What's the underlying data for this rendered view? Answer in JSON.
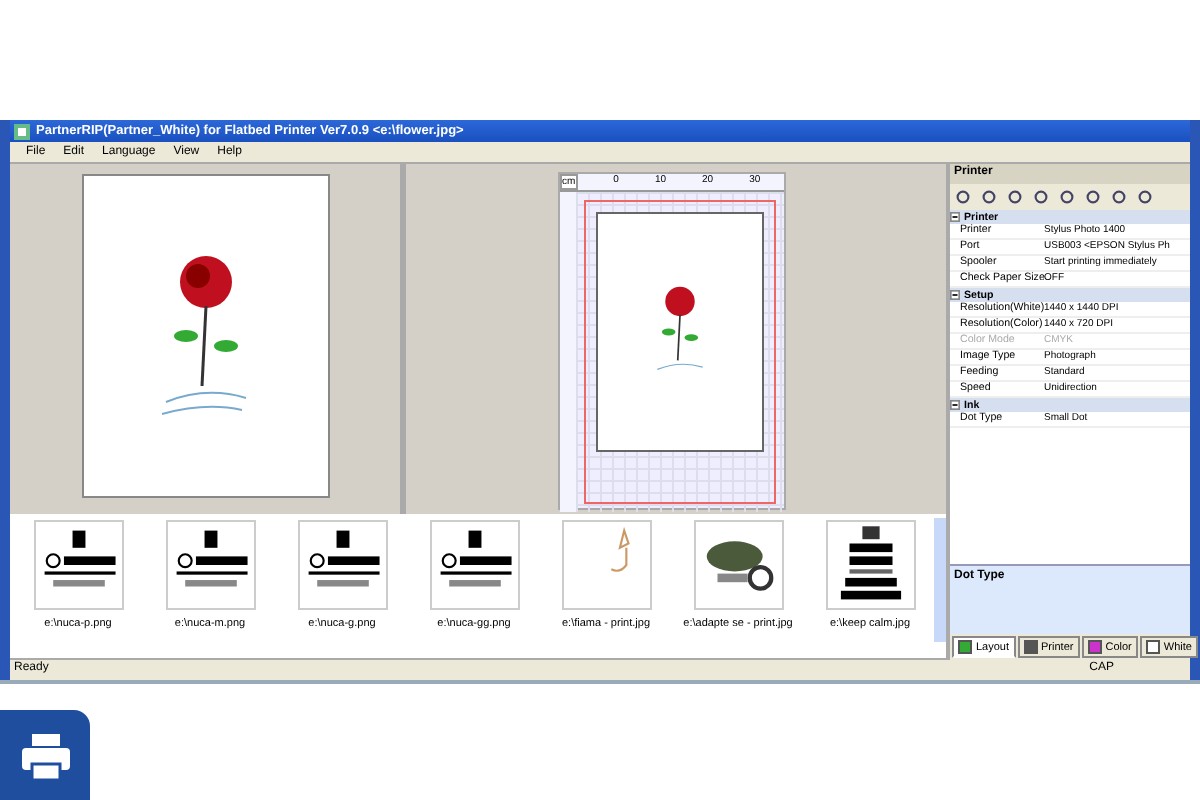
{
  "window": {
    "title": "PartnerRIP(Partner_White) for Flatbed Printer Ver7.0.9 <e:\\flower.jpg>"
  },
  "menu": [
    "File",
    "Edit",
    "Language",
    "View",
    "Help"
  ],
  "ruler": {
    "unit": "cm",
    "ticks": [
      "0",
      "10",
      "20",
      "30"
    ]
  },
  "panel": {
    "title": "Printer",
    "sections": [
      {
        "name": "Printer",
        "expanded": true,
        "rows": [
          {
            "label": "Printer",
            "value": "Stylus Photo 1400",
            "disabled": false
          },
          {
            "label": "Port",
            "value": "USB003 <EPSON Stylus Ph",
            "disabled": false
          },
          {
            "label": "Spooler",
            "value": "Start printing immediately",
            "disabled": false
          },
          {
            "label": "Check Paper Size",
            "value": "OFF",
            "disabled": false
          }
        ]
      },
      {
        "name": "Setup",
        "expanded": true,
        "rows": [
          {
            "label": "Resolution(White)",
            "value": "1440 x 1440 DPI",
            "disabled": false
          },
          {
            "label": "Resolution(Color)",
            "value": "1440 x 720 DPI",
            "disabled": false
          },
          {
            "label": "Color Mode",
            "value": "CMYK",
            "disabled": true
          },
          {
            "label": "Image Type",
            "value": "Photograph",
            "disabled": false
          },
          {
            "label": "Feeding",
            "value": "Standard",
            "disabled": false
          },
          {
            "label": "Speed",
            "value": "Unidirection",
            "disabled": false
          }
        ]
      },
      {
        "name": "Ink",
        "expanded": true,
        "rows": [
          {
            "label": "Dot Type",
            "value": "Small Dot",
            "disabled": false
          }
        ]
      }
    ],
    "description_title": "Dot Type",
    "tabs": [
      {
        "label": "Layout",
        "kind": "layout",
        "selected": true
      },
      {
        "label": "Printer",
        "kind": "printer",
        "selected": false
      },
      {
        "label": "Color",
        "kind": "color",
        "selected": false
      },
      {
        "label": "White",
        "kind": "white",
        "selected": false
      }
    ]
  },
  "thumbnails": [
    {
      "caption": "e:\\nuca-p.png",
      "kind": "logo"
    },
    {
      "caption": "e:\\nuca-m.png",
      "kind": "logo"
    },
    {
      "caption": "e:\\nuca-g.png",
      "kind": "logo"
    },
    {
      "caption": "e:\\nuca-gg.png",
      "kind": "logo"
    },
    {
      "caption": "e:\\fiama - print.jpg",
      "kind": "sketch"
    },
    {
      "caption": "e:\\adapte se - print.jpg",
      "kind": "lizard"
    },
    {
      "caption": "e:\\keep calm.jpg",
      "kind": "poster"
    }
  ],
  "status_bar": {
    "text": "Ready",
    "indicator": "CAP"
  }
}
